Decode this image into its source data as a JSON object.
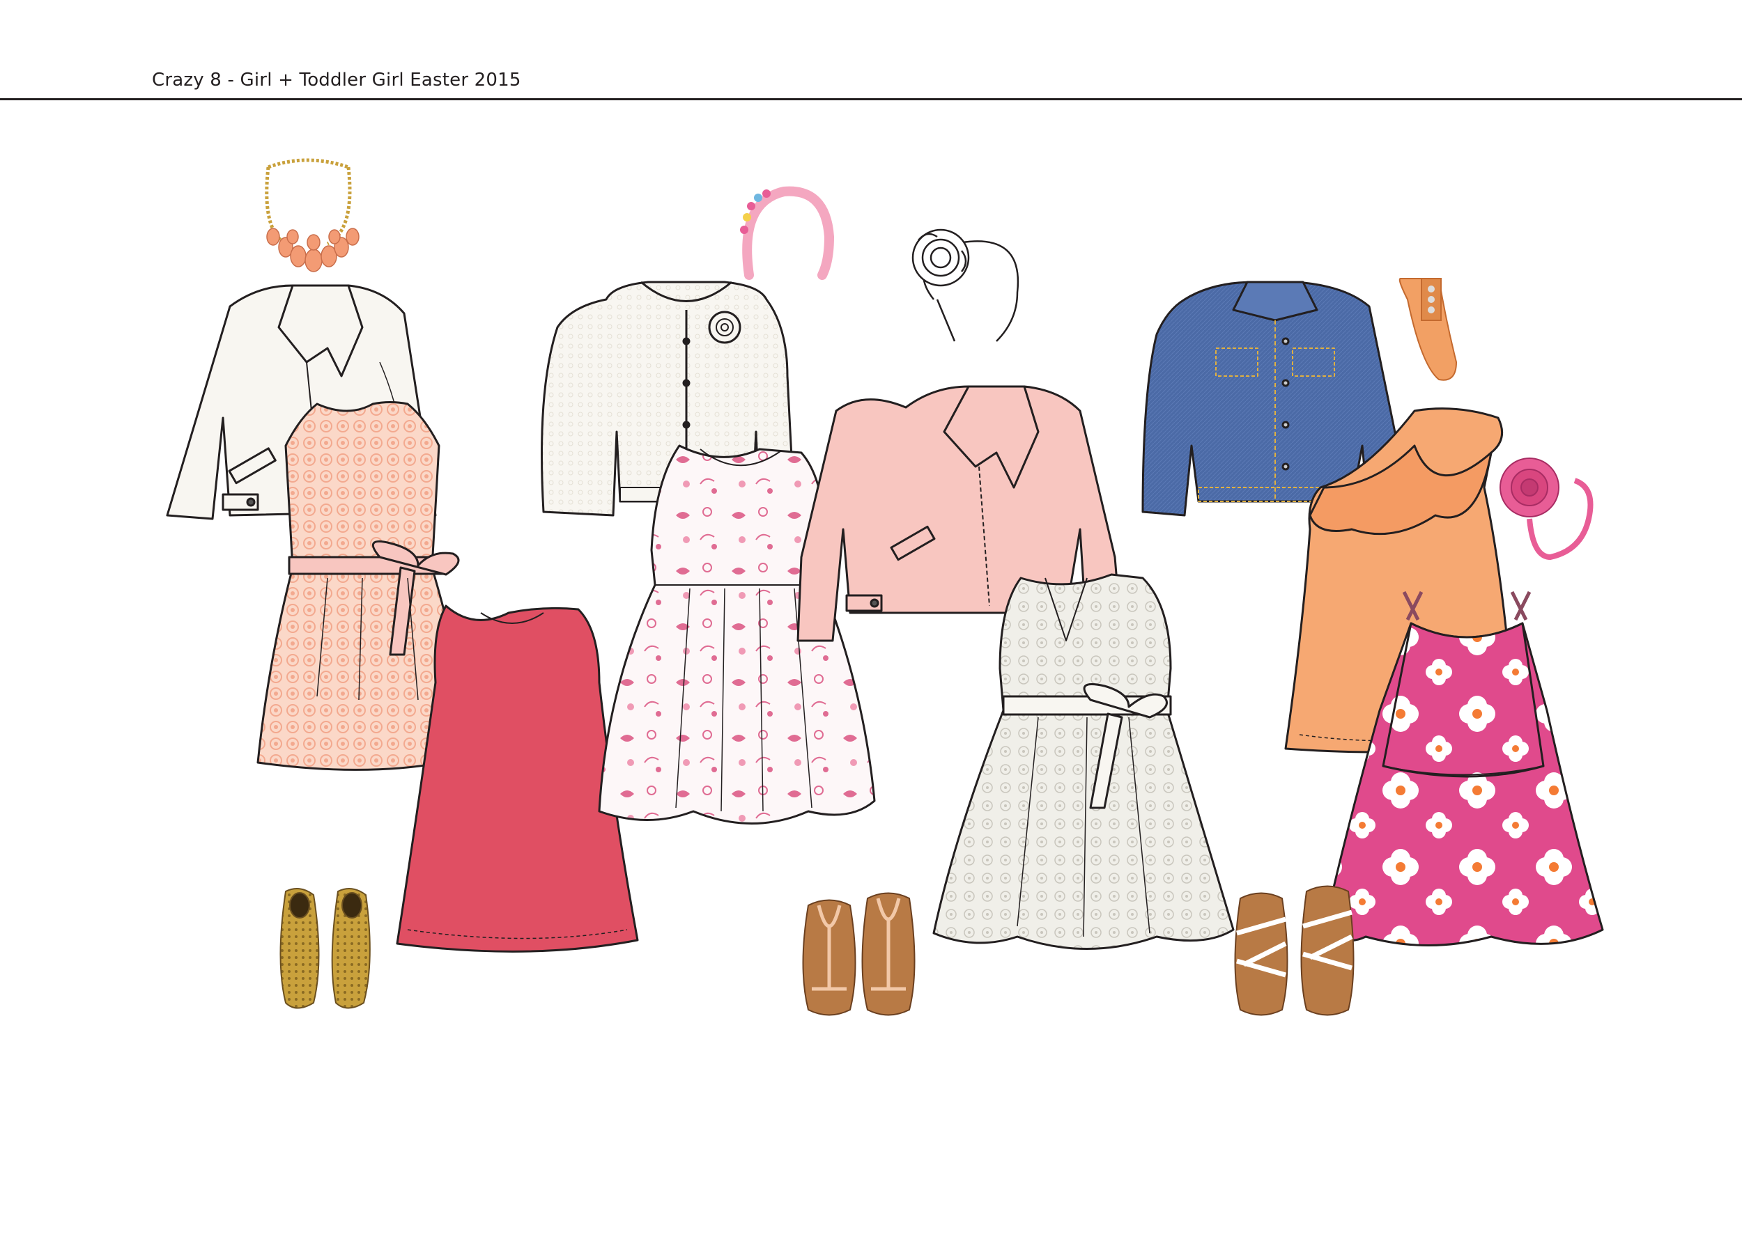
{
  "header": {
    "title": "Crazy 8 - Girl + Toddler Girl Easter 2015"
  },
  "palette": {
    "ink": "#231f20",
    "white_garment": "#f8f6f1",
    "peach_print": "#fbd8c8",
    "coral_dress": "#e04f63",
    "blush_jacket": "#f8c6c0",
    "denim": "#4b6aa6",
    "orange_top": "#f6a872",
    "pink_print": "#e04a8c",
    "gold": "#c9a13c",
    "tan_leather": "#b87a45",
    "headband_pink": "#e85d96"
  },
  "outfits": [
    {
      "id": "look-1",
      "items": [
        "necklace",
        "white-moto-jacket",
        "peach-lace-dress-with-bow",
        "coral-shift-dress",
        "gold-ballet-flats"
      ]
    },
    {
      "id": "look-2",
      "items": [
        "pink-beaded-headband",
        "white-textured-cardigan",
        "floral-bird-print-dress",
        "tan-t-strap-sandals"
      ]
    },
    {
      "id": "look-3",
      "items": [
        "white-rosette-headband",
        "blush-moto-jacket",
        "white-eyelet-dress-with-bow"
      ]
    },
    {
      "id": "look-4",
      "items": [
        "peach-turban-headband",
        "denim-jacket",
        "orange-one-shoulder-ruffle-top",
        "pink-rosette-headband",
        "pink-floral-popover-dress",
        "white-strap-sandals"
      ]
    }
  ]
}
